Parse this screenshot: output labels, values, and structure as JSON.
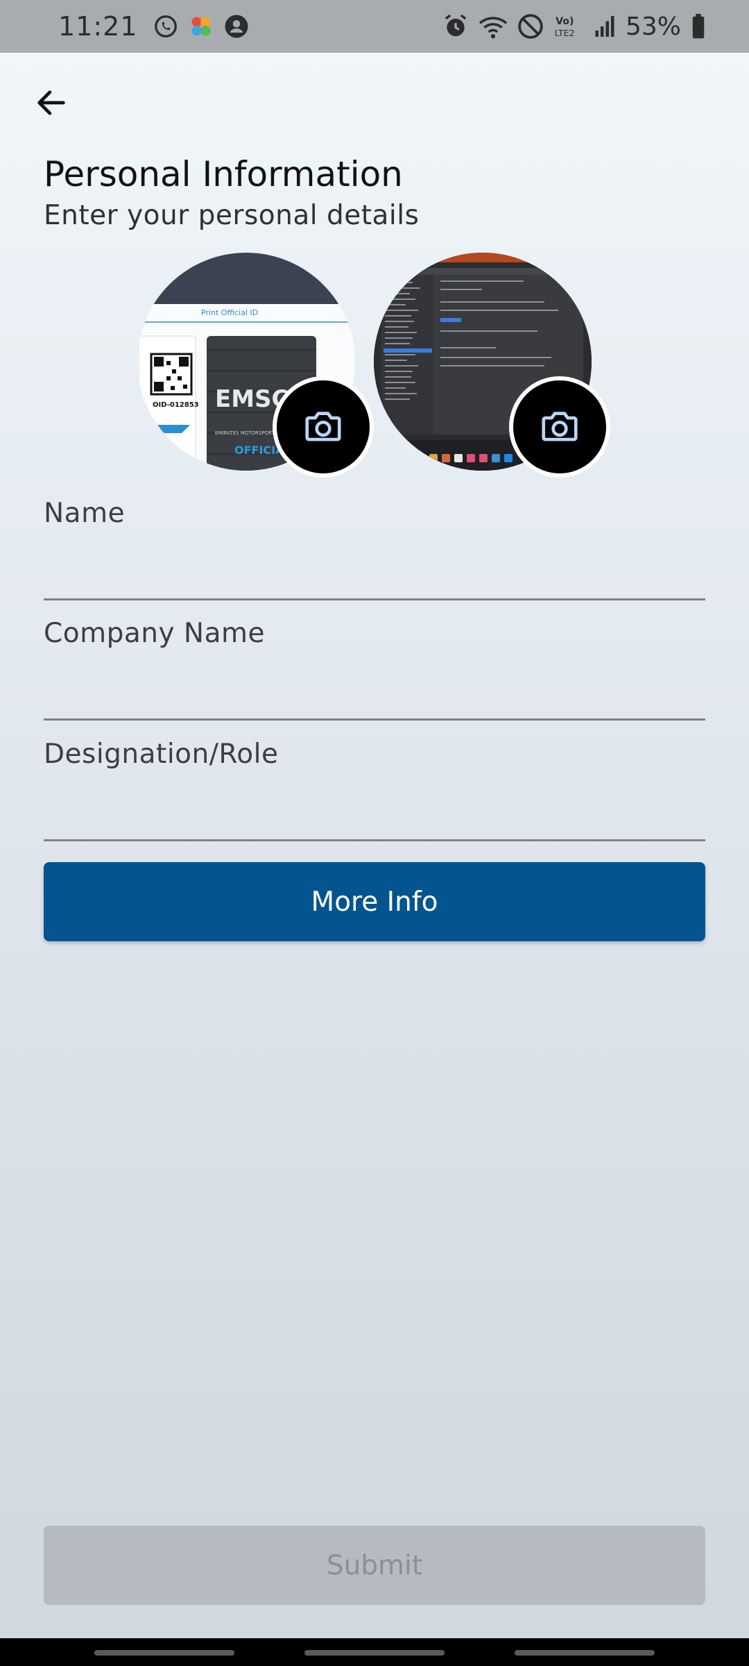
{
  "status_bar": {
    "time": "11:21",
    "battery_pct": "53%",
    "left_icons": [
      "whatsapp-icon",
      "app-icon",
      "account-icon"
    ],
    "right_icons": [
      "alarm-icon",
      "wifi-icon",
      "dnd-icon",
      "volte-icon",
      "signal-icon",
      "battery-icon"
    ]
  },
  "header": {
    "back_icon": "arrow-left-icon",
    "title": "Personal Information",
    "subtitle": "Enter your personal details"
  },
  "photos": {
    "id_card": {
      "label_top": "Print Official ID",
      "id_number": "OID-012853",
      "brand": "EMSC",
      "brand_sub": "EMIRATES MOTORSPORTS",
      "tag": "OFFICIA"
    },
    "camera_icon": "camera-icon"
  },
  "form": {
    "fields": [
      {
        "label": "Name",
        "value": ""
      },
      {
        "label": "Company Name",
        "value": ""
      },
      {
        "label": "Designation/Role",
        "value": ""
      }
    ],
    "more_info_label": "More Info",
    "submit_label": "Submit"
  },
  "colors": {
    "primary": "#03548f",
    "disabled": "#b5bbc0",
    "status_bar": "#a9acae"
  }
}
